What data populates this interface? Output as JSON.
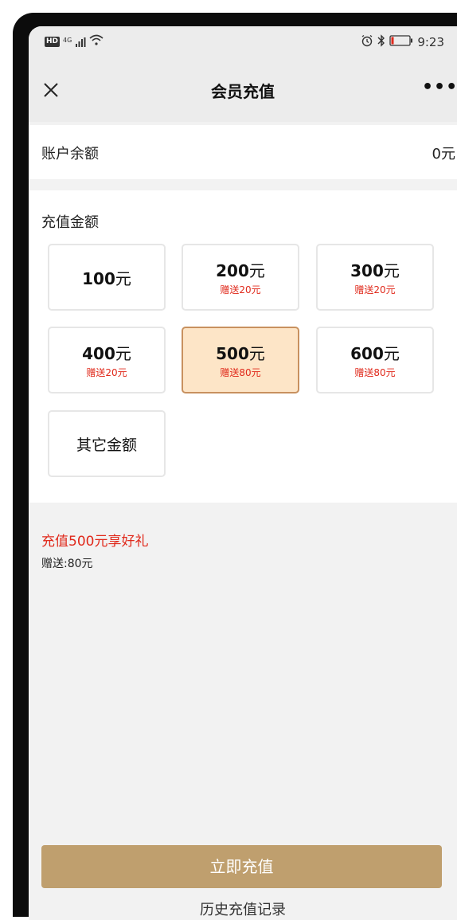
{
  "status_bar": {
    "network": "4G",
    "time": "9:23"
  },
  "nav": {
    "title": "会员充值",
    "more": "•••"
  },
  "balance": {
    "label": "账户余额",
    "value": "0元"
  },
  "recharge": {
    "title": "充值金额",
    "options": [
      {
        "amount": "100",
        "unit": "元",
        "bonus": ""
      },
      {
        "amount": "200",
        "unit": "元",
        "bonus": "赠送20元"
      },
      {
        "amount": "300",
        "unit": "元",
        "bonus": "赠送20元"
      },
      {
        "amount": "400",
        "unit": "元",
        "bonus": "赠送20元"
      },
      {
        "amount": "500",
        "unit": "元",
        "bonus": "赠送80元",
        "selected": true
      },
      {
        "amount": "600",
        "unit": "元",
        "bonus": "赠送80元"
      }
    ],
    "other_label": "其它金额"
  },
  "promo": {
    "title": "充值500元享好礼",
    "detail": "赠送:80元"
  },
  "actions": {
    "submit": "立即充值",
    "history": "历史充值记录"
  }
}
